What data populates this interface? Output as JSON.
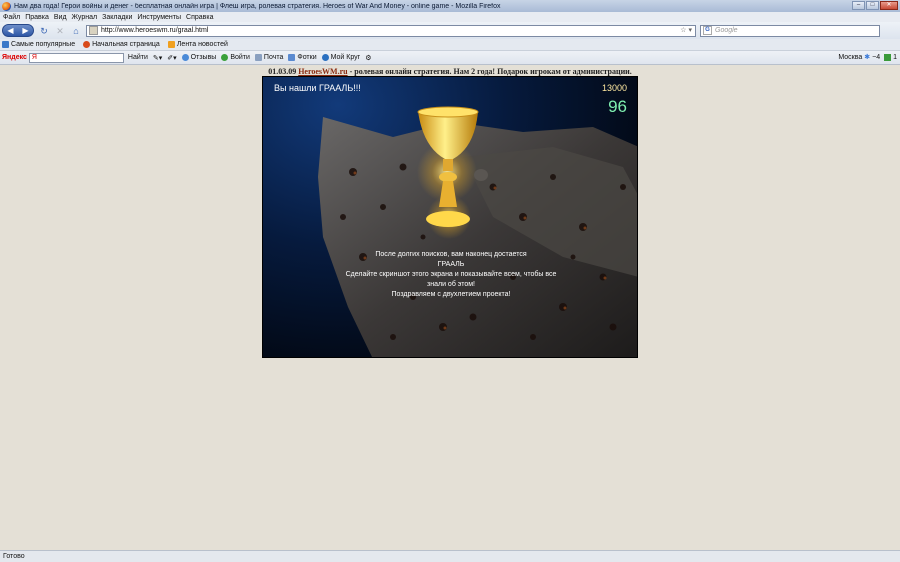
{
  "window": {
    "title": "Нам два года! Герои войны и денег - бесплатная онлайн игра | Флеш игра, ролевая стратегия. Heroes of War And Money - online game - Mozilla Firefox"
  },
  "menu": [
    {
      "label": "Файл"
    },
    {
      "label": "Правка"
    },
    {
      "label": "Вид"
    },
    {
      "label": "Журнал"
    },
    {
      "label": "Закладки"
    },
    {
      "label": "Инструменты"
    },
    {
      "label": "Справка"
    }
  ],
  "navbar": {
    "url": "http://www.heroeswm.ru/graal.html",
    "search_placeholder": "Google"
  },
  "bookmarks": [
    {
      "label": "Самые популярные",
      "color": "#3a78c8"
    },
    {
      "label": "Начальная страница",
      "color": "#d84a1a"
    },
    {
      "label": "Лента новостей",
      "color": "#f0a020"
    }
  ],
  "yandex_bar": {
    "logo": "Яндекс",
    "find": "Найти",
    "reviews": "Отзывы",
    "login": "Войти",
    "mail": "Почта",
    "photos": "Фотки",
    "my_circle": "Мой Круг",
    "city": "Москва",
    "temperature": "−4",
    "mail_count": "1"
  },
  "page": {
    "date": "01.03.09",
    "site_link": "HeroesWM.ru",
    "announcement": "- ролевая онлайн стратегия. Нам 2 года! Подарок игрокам от администрации."
  },
  "game": {
    "found_message": "Вы нашли ГРААЛЬ!!!",
    "score": "13000",
    "counter": "96",
    "congrats": [
      "После долгих поисков, вам наконец достается",
      "ГРААЛЬ",
      "Сделайте скриншот этого экрана и показывайте всем, чтобы все",
      "знали об этом!",
      "Поздравляем с двухлетием проекта!"
    ]
  },
  "status": {
    "text": "Готово"
  }
}
